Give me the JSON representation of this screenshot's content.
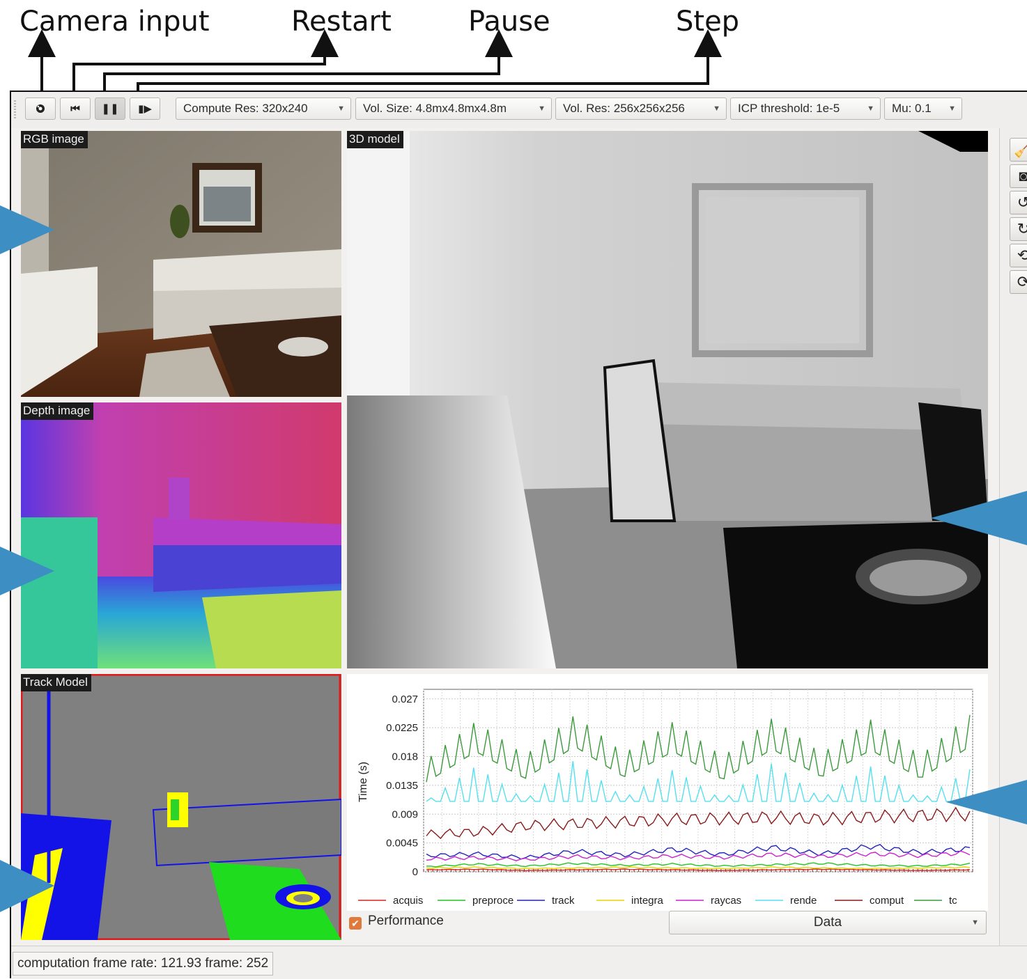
{
  "annotations": {
    "camera_input": "Camera input",
    "restart": "Restart",
    "pause": "Pause",
    "step": "Step"
  },
  "toolbar": {
    "compute_res": "Compute Res: 320x240",
    "vol_size": "Vol. Size: 4.8mx4.8mx4.8m",
    "vol_res": "Vol. Res: 256x256x256",
    "icp_threshold": "ICP threshold: 1e-5",
    "mu": "Mu: 0.1"
  },
  "panels": {
    "rgb": "RGB image",
    "depth": "Depth image",
    "model3d": "3D model",
    "track": "Track Model"
  },
  "controls": {
    "performance_label": "Performance",
    "performance_checked": true,
    "data_select": "Data"
  },
  "status": {
    "text": "computation frame rate: 121.93 frame: 252"
  },
  "colors": {
    "accent": "#e07a3c",
    "callout": "#3d8ec2"
  },
  "chart_data": {
    "type": "line",
    "ylabel": "Time (s)",
    "ylim": [
      0,
      0.0285
    ],
    "yticks": [
      "0.027",
      "0.0225",
      "0.018",
      "0.0135",
      "0.009",
      "0.0045",
      "0"
    ],
    "grid": true,
    "legend_placement": "bottom",
    "samples": 116,
    "series": [
      {
        "name": "acquis",
        "color": "#d62424",
        "values": [
          0.0003,
          0.0004,
          0.0002,
          0.0003,
          0.0004,
          0.0003,
          0.0002,
          0.0003,
          0.0004,
          0.0003,
          0.0002,
          0.0003
        ]
      },
      {
        "name": "preproce",
        "color": "#22c422",
        "values": [
          0.0008,
          0.0012,
          0.0009,
          0.0013,
          0.001,
          0.0012,
          0.0009,
          0.0011,
          0.0013,
          0.001,
          0.0009,
          0.0012
        ]
      },
      {
        "name": "track",
        "color": "#2222bb",
        "values": [
          0.0025,
          0.0028,
          0.0022,
          0.0032,
          0.0026,
          0.0035,
          0.0027,
          0.0038,
          0.0028,
          0.004,
          0.003,
          0.0036
        ]
      },
      {
        "name": "integra",
        "color": "#e8d400",
        "values": [
          0.0006,
          0.0007,
          0.0005,
          0.0006,
          0.0007,
          0.0006,
          0.0005,
          0.0007,
          0.0006,
          0.0005,
          0.0006,
          0.0007
        ]
      },
      {
        "name": "raycas",
        "color": "#cc22cc",
        "values": [
          0.002,
          0.0022,
          0.0019,
          0.0024,
          0.0021,
          0.0025,
          0.0022,
          0.0027,
          0.0024,
          0.0028,
          0.0025,
          0.003
        ]
      },
      {
        "name": "rende",
        "color": "#55e0ee",
        "values": [
          0.011,
          0.0165,
          0.0112,
          0.0175,
          0.0115,
          0.016,
          0.0112,
          0.017,
          0.0114,
          0.0165,
          0.0112,
          0.016
        ]
      },
      {
        "name": "comput",
        "color": "#8b1a1a",
        "values": [
          0.0058,
          0.0062,
          0.0072,
          0.0075,
          0.0078,
          0.0082,
          0.0083,
          0.0085,
          0.0082,
          0.0086,
          0.0088,
          0.009
        ]
      },
      {
        "name": "tc",
        "color": "#3b9a3b",
        "values": [
          0.0175,
          0.0235,
          0.0182,
          0.0245,
          0.0185,
          0.0235,
          0.018,
          0.024,
          0.0185,
          0.0238,
          0.0182,
          0.0245
        ]
      }
    ]
  }
}
